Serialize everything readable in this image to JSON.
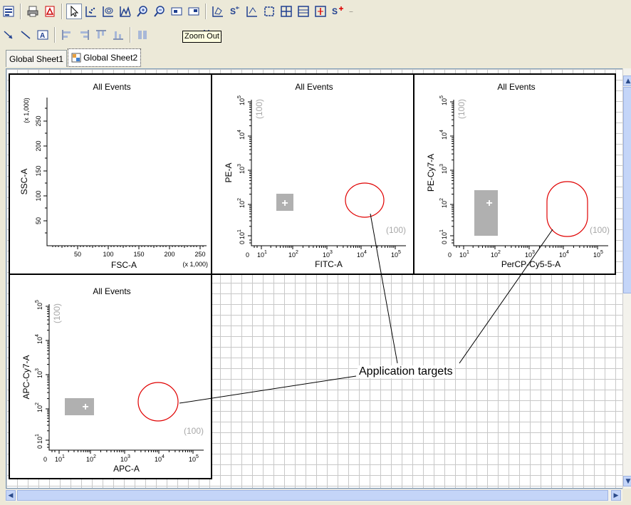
{
  "toolbar1": {
    "icons": [
      "properties-icon",
      "print-icon",
      "pdf-icon",
      "pointer-icon",
      "scatter-plot-icon",
      "contour-plot-icon",
      "histogram-icon",
      "zoom-in-icon",
      "zoom-out-icon",
      "grid-toggle-icon",
      "gate-view-icon",
      "polygon-gate-icon",
      "snap-to-gate-icon",
      "interval-gate-icon",
      "rectangle-gate-icon",
      "quadrant-gate-icon",
      "binner-icon",
      "interval-range-icon",
      "spider-gate-icon"
    ],
    "selected": "pointer-icon"
  },
  "toolbar2": {
    "icons": [
      "arrow-icon",
      "line-icon",
      "text-box-icon",
      "align-left-icon",
      "align-right-icon",
      "align-top-icon",
      "align-bottom-icon",
      "distribute-icon",
      "grid-snap-icon"
    ]
  },
  "tooltip": "Zoom Out",
  "tabs": [
    {
      "label": "Global Sheet1",
      "active": false
    },
    {
      "label": "Global Sheet2",
      "active": true
    }
  ],
  "plots": [
    {
      "title": "All Events",
      "xlabel": "FSC-A",
      "ylabel": "SSC-A",
      "xticks": [
        "50",
        "100",
        "150",
        "200",
        "250"
      ],
      "yticks": [
        "50",
        "100",
        "150",
        "200",
        "250"
      ],
      "xmult": "(x 1,000)",
      "ymult": "(x 1,000)"
    },
    {
      "title": "All Events",
      "xlabel": "FITC-A",
      "ylabel": "PE-A",
      "axis_min": "0",
      "decades": [
        "10",
        "10",
        "10",
        "10",
        "10"
      ],
      "exponents": [
        "1",
        "2",
        "3",
        "4",
        "5"
      ],
      "axis_label_top": "(100)",
      "axis_label_right": "(100)",
      "plus": "+"
    },
    {
      "title": "All Events",
      "xlabel": "PerCP-Cy5-5-A",
      "ylabel": "PE-Cy7-A",
      "axis_min": "0",
      "decades": [
        "10",
        "10",
        "10",
        "10",
        "10"
      ],
      "exponents": [
        "1",
        "2",
        "3",
        "4",
        "5"
      ],
      "axis_label_top": "(100)",
      "axis_label_right": "(100)",
      "plus": "+"
    },
    {
      "title": "All Events",
      "xlabel": "APC-A",
      "ylabel": "APC-Cy7-A",
      "axis_min": "0",
      "decades": [
        "10",
        "10",
        "10",
        "10",
        "10"
      ],
      "exponents": [
        "1",
        "2",
        "3",
        "4",
        "5"
      ],
      "axis_label_top": "(100)",
      "axis_label_right": "(100)",
      "plus": "+"
    }
  ],
  "callout": "Application targets",
  "colors": {
    "target": "#e00000",
    "gate": "#b0b0b0"
  }
}
